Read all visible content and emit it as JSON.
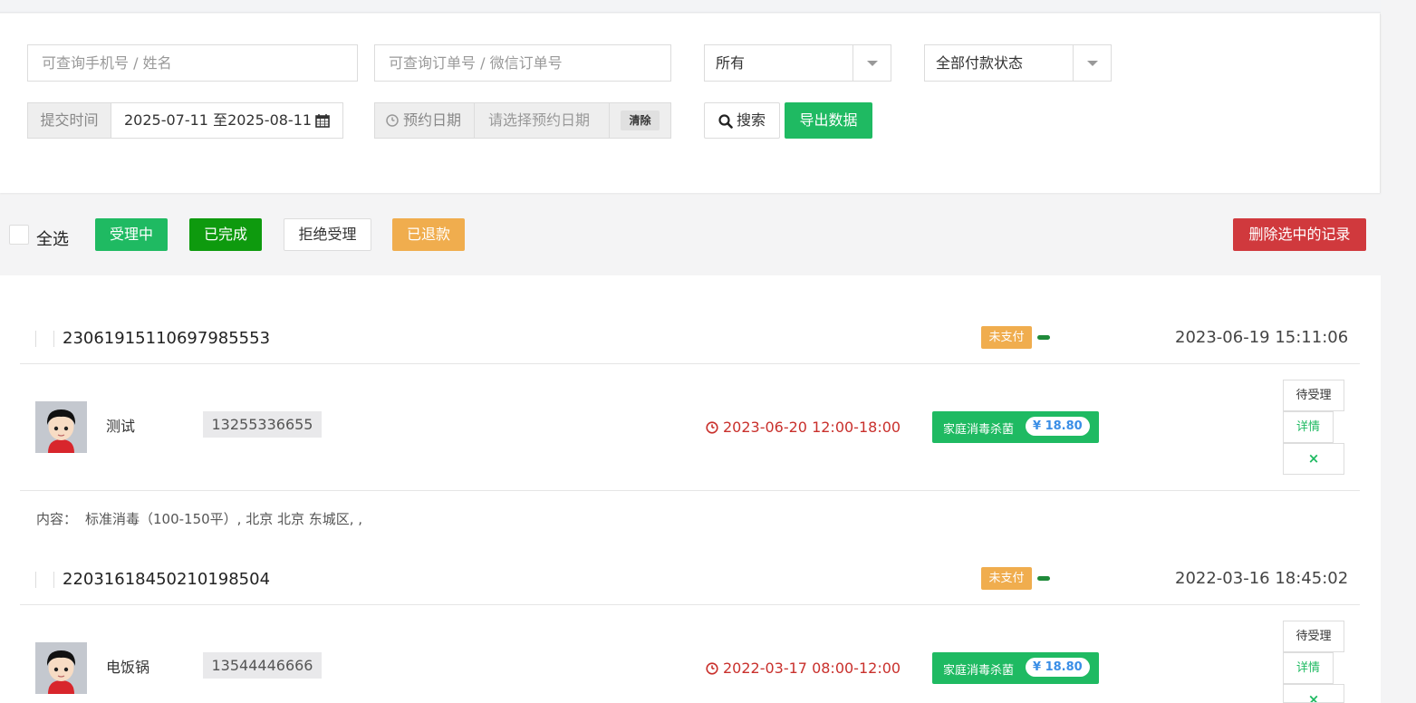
{
  "filters": {
    "phone_placeholder": "可查询手机号 / 姓名",
    "order_placeholder": "可查询订单号 / 微信订单号",
    "status_select": "所有",
    "pay_status_select": "全部付款状态",
    "submit_time_label": "提交时间",
    "submit_time_value": "2025-07-11 至2025-08-11",
    "appt_label": "预约日期",
    "appt_placeholder": "请选择预约日期",
    "clear_label": "清除",
    "search_label": "搜索",
    "export_label": "导出数据"
  },
  "toolbar": {
    "select_all": "全选",
    "processing": "受理中",
    "completed": "已完成",
    "rejected": "拒绝受理",
    "refunded": "已退款",
    "delete_selected": "删除选中的记录"
  },
  "colors": {
    "green": "#1fba62",
    "dark_green": "#0e9a0e",
    "orange": "#f0ad4e",
    "red": "#d0393d"
  },
  "orders": [
    {
      "order_no": "2306191511069798555З",
      "pay_status": "未支付",
      "created_at": "2023-06-19 15:11:06",
      "name": "测试",
      "phone": "13255336655",
      "appointment": "2023-06-20 12:00-18:00",
      "service": "家庭消毒杀菌",
      "price": "¥ 18.80",
      "status_btn": "待受理",
      "detail_btn": "详情",
      "delete_icon": "×",
      "content_label": "内容：",
      "content": "标准消毒（100-150平）, 北京 北京 东城区, ,"
    },
    {
      "order_no": "2203161845021019850​4",
      "pay_status": "未支付",
      "created_at": "2022-03-16 18:45:02",
      "name": "电饭锅",
      "phone": "13544446666",
      "appointment": "2022-03-17 08:00-12:00",
      "service": "家庭消毒杀菌",
      "price": "¥ 18.80",
      "status_btn": "待受理",
      "detail_btn": "详情",
      "delete_icon": "×"
    }
  ]
}
